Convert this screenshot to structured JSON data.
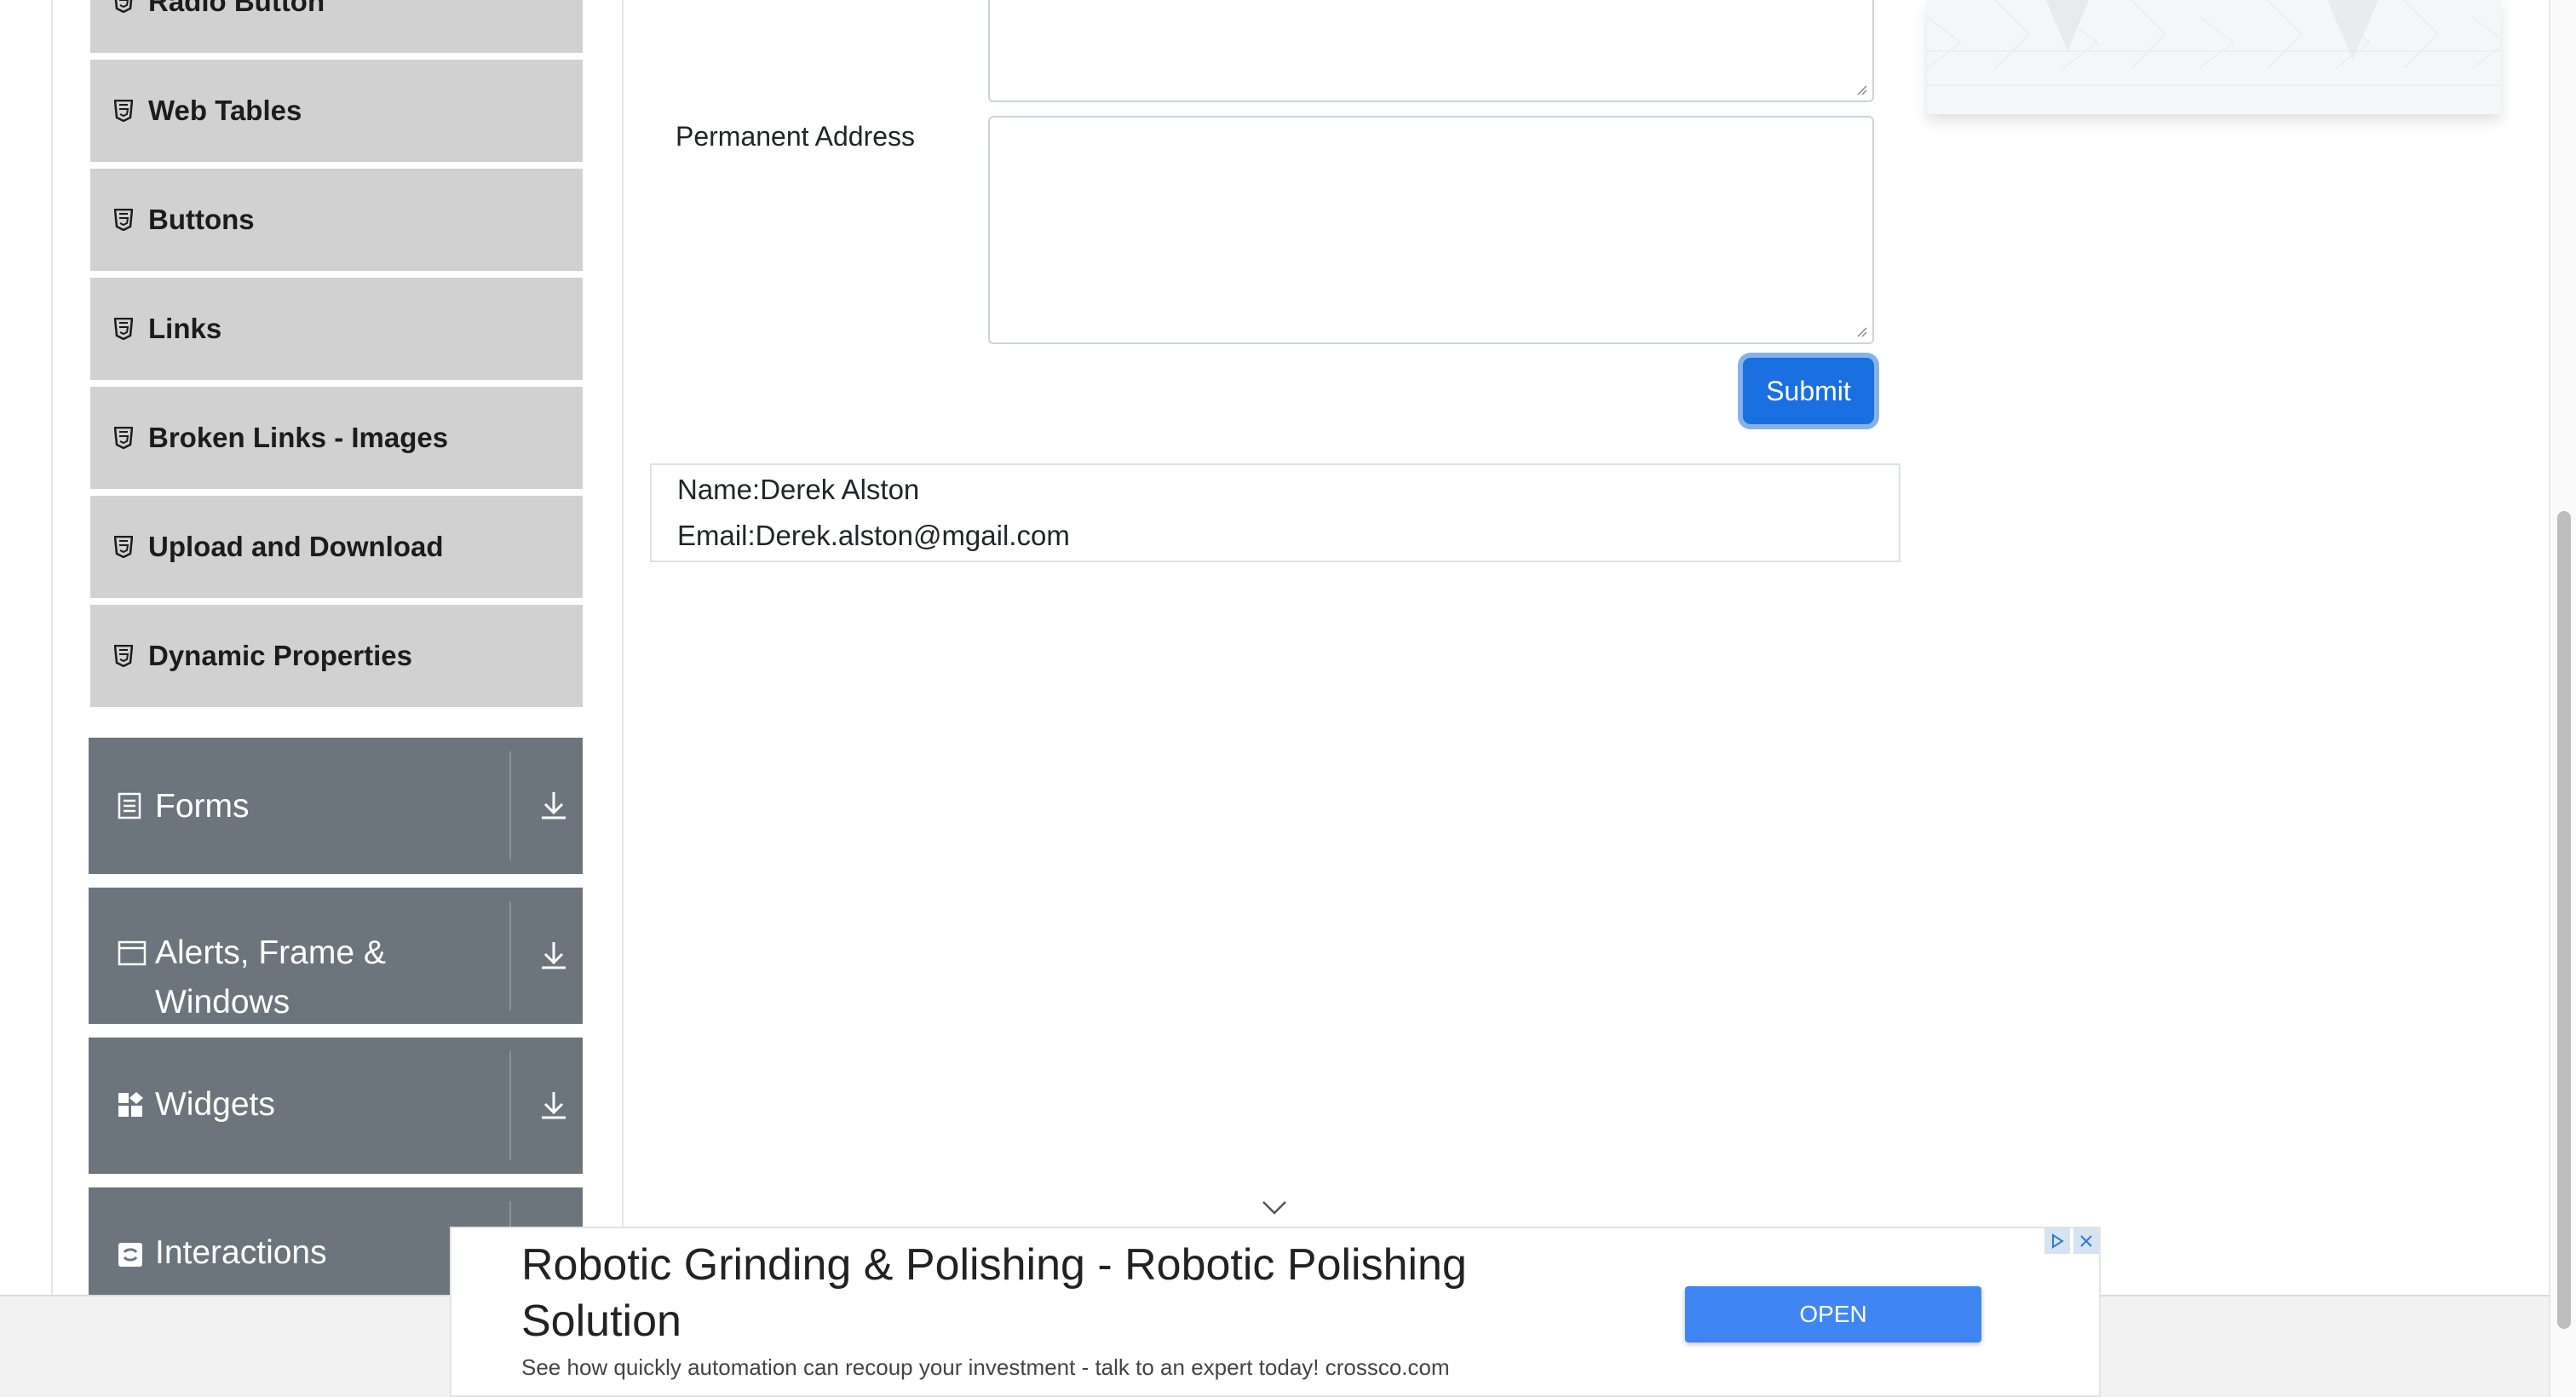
{
  "sidebar": {
    "elements_items": [
      {
        "label": "Radio Button"
      },
      {
        "label": "Web Tables"
      },
      {
        "label": "Buttons"
      },
      {
        "label": "Links"
      },
      {
        "label": "Broken Links - Images"
      },
      {
        "label": "Upload and Download"
      },
      {
        "label": "Dynamic Properties"
      }
    ],
    "groups": [
      {
        "label": "Forms",
        "icon": "form-icon"
      },
      {
        "label_line1": "Alerts, Frame &",
        "label_line2": "Windows",
        "icon": "window-icon"
      },
      {
        "label": "Widgets",
        "icon": "widgets-icon"
      },
      {
        "label": "Interactions",
        "icon": "interactions-icon"
      }
    ]
  },
  "form": {
    "permanent_address_label": "Permanent Address",
    "submit_label": "Submit"
  },
  "output": {
    "name": "Name:Derek Alston",
    "email": "Email:Derek.alston@mgail.com"
  },
  "ad": {
    "title": "Robotic Grinding & Polishing - Robotic Polishing Solution",
    "description": "See how quickly automation can recoup your investment - talk to an expert today! crossco.com",
    "cta": "OPEN"
  },
  "colors": {
    "submit": "#1a6fe0",
    "group_bg": "#6c757d",
    "subitem_bg": "#d1d1d1",
    "ad_button": "#3f86f4"
  }
}
